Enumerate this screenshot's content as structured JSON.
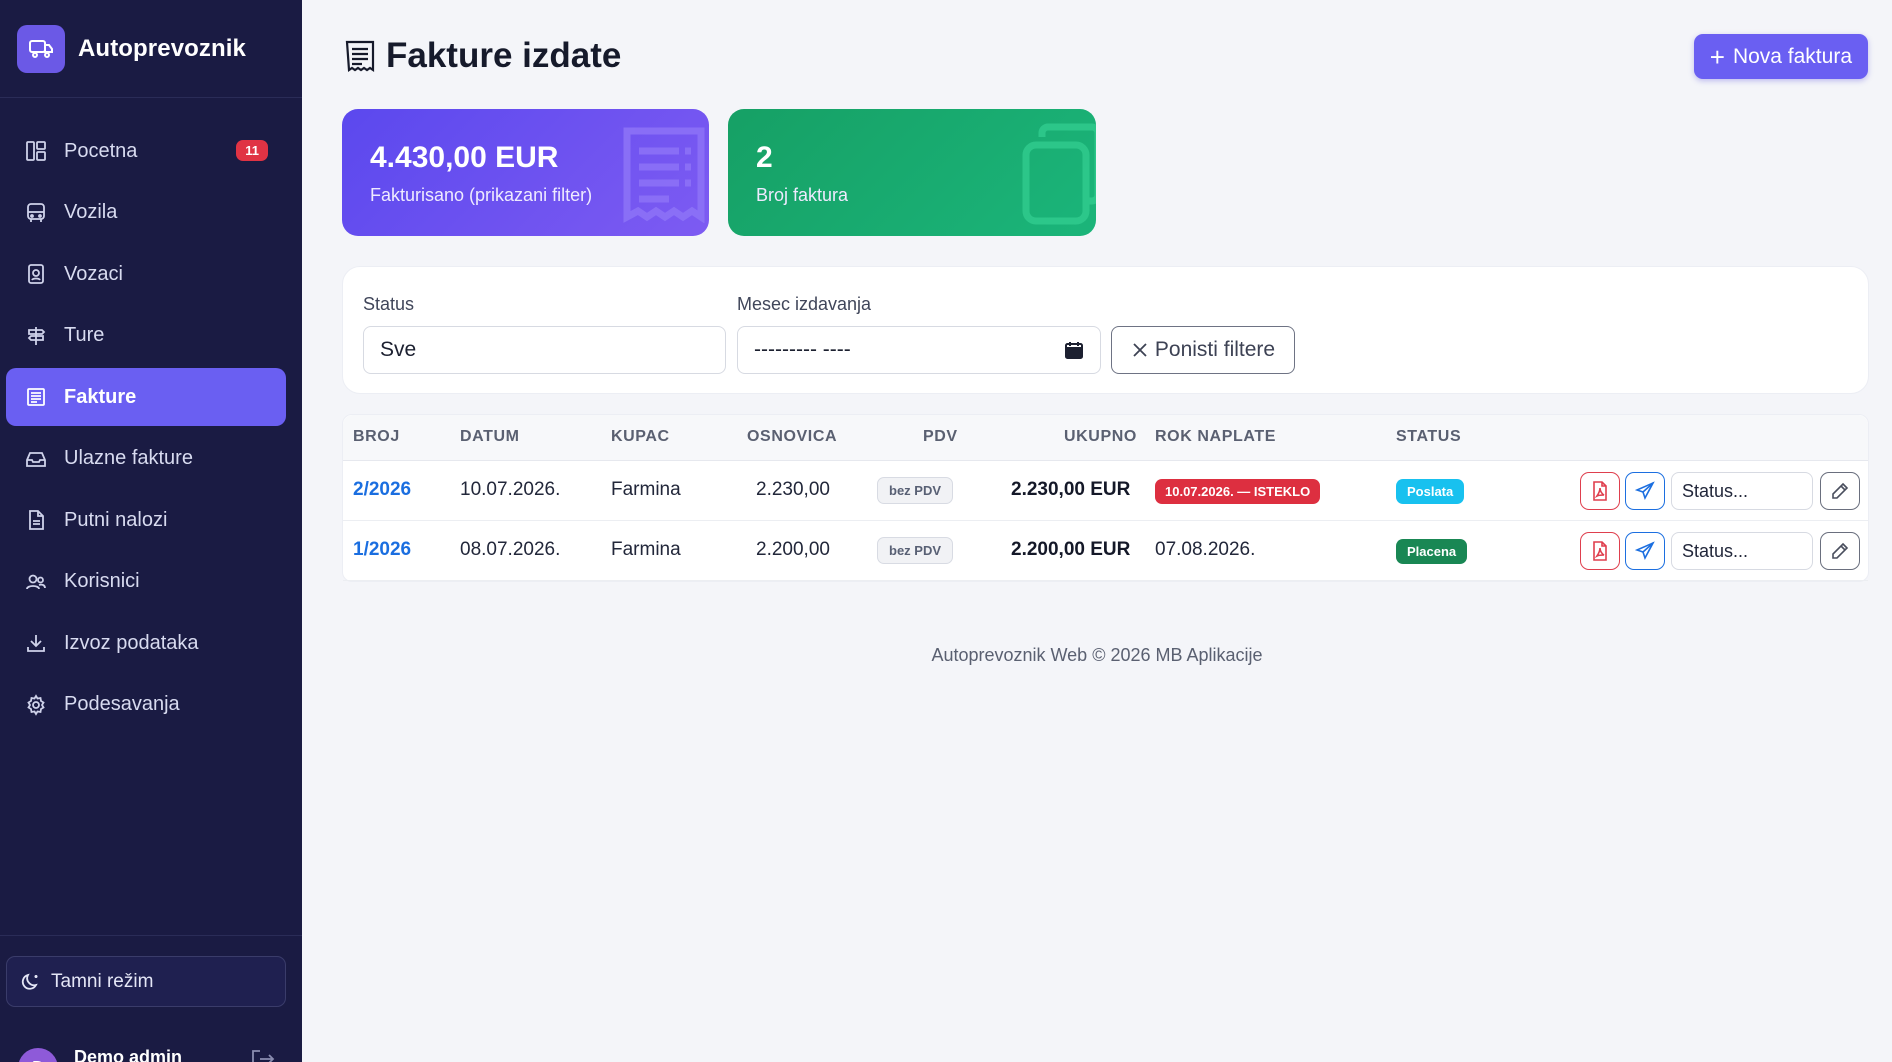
{
  "brand": {
    "name": "Autoprevoznik"
  },
  "sidebar": {
    "items": [
      {
        "label": "Pocetna",
        "icon": "dashboard-icon",
        "badge": "11"
      },
      {
        "label": "Vozila",
        "icon": "bus-icon"
      },
      {
        "label": "Vozaci",
        "icon": "id-badge-icon"
      },
      {
        "label": "Ture",
        "icon": "signpost-icon"
      },
      {
        "label": "Fakture",
        "icon": "receipt-icon",
        "active": true
      },
      {
        "label": "Ulazne fakture",
        "icon": "inbox-icon"
      },
      {
        "label": "Putni nalozi",
        "icon": "document-icon"
      },
      {
        "label": "Korisnici",
        "icon": "users-icon"
      },
      {
        "label": "Izvoz podataka",
        "icon": "download-icon"
      },
      {
        "label": "Podesavanja",
        "icon": "gear-icon"
      }
    ],
    "dark_mode_label": "Tamni režim",
    "user": {
      "name": "Demo admin",
      "initial": "D"
    }
  },
  "header": {
    "title": "Fakture izdate",
    "new_button_label": "Nova faktura"
  },
  "stats": [
    {
      "value": "4.430,00 EUR",
      "label": "Fakturisano (prikazani filter)"
    },
    {
      "value": "2",
      "label": "Broj faktura"
    }
  ],
  "filters": {
    "status_label": "Status",
    "status_value": "Sve",
    "month_label": "Mesec izdavanja",
    "month_value": "--------- ----",
    "reset_label": "Ponisti filtere"
  },
  "table": {
    "columns": [
      "BROJ",
      "DATUM",
      "KUPAC",
      "OSNOVICA",
      "PDV",
      "UKUPNO",
      "ROK NAPLATE",
      "STATUS"
    ],
    "rows": [
      {
        "broj": "2/2026",
        "datum": "10.07.2026.",
        "kupac": "Farmina",
        "osnovica": "2.230,00",
        "pdv": "bez PDV",
        "ukupno": "2.230,00 EUR",
        "rok": "10.07.2026. — ISTEKLO",
        "rok_expired": true,
        "status": "Poslata",
        "status_select": "Status..."
      },
      {
        "broj": "1/2026",
        "datum": "08.07.2026.",
        "kupac": "Farmina",
        "osnovica": "2.200,00",
        "pdv": "bez PDV",
        "ukupno": "2.200,00 EUR",
        "rok": "07.08.2026.",
        "rok_expired": false,
        "status": "Placena",
        "status_select": "Status..."
      }
    ]
  },
  "footer": {
    "text": "Autoprevoznik Web © 2026 MB Aplikacije"
  },
  "colors": {
    "sidebar_bg": "#1a1b43",
    "accent": "#6a5ff2",
    "success": "#198754",
    "danger": "#dd2f40",
    "info": "#18c1ef"
  }
}
